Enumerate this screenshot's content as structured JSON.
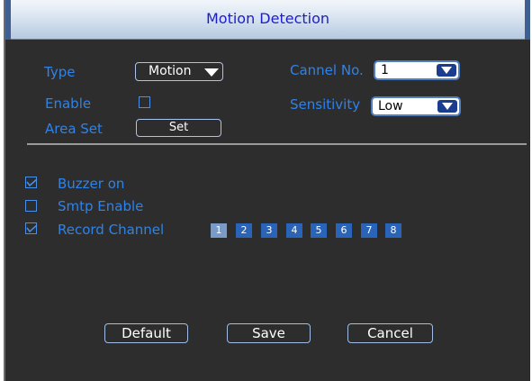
{
  "window": {
    "title": "Motion Detection"
  },
  "form": {
    "type_label": "Type",
    "type_value": "Motion",
    "enable_label": "Enable",
    "area_set_label": "Area Set",
    "area_set_button": "Set",
    "channel_label": "Cannel No.",
    "channel_value": "1",
    "sensitivity_label": "Sensitivity",
    "sensitivity_value": "Low"
  },
  "options": {
    "buzzer_label": "Buzzer on",
    "buzzer_checked": true,
    "smtp_label": "Smtp Enable",
    "smtp_checked": false,
    "record_label": "Record Channel",
    "record_checked": true,
    "channels": [
      "1",
      "2",
      "3",
      "4",
      "5",
      "6",
      "7",
      "8"
    ]
  },
  "buttons": {
    "default": "Default",
    "save": "Save",
    "cancel": "Cancel"
  },
  "colors": {
    "label_blue": "#2f83e8",
    "title_blue": "#1d1dc7",
    "panel": "#2d2d2d"
  }
}
